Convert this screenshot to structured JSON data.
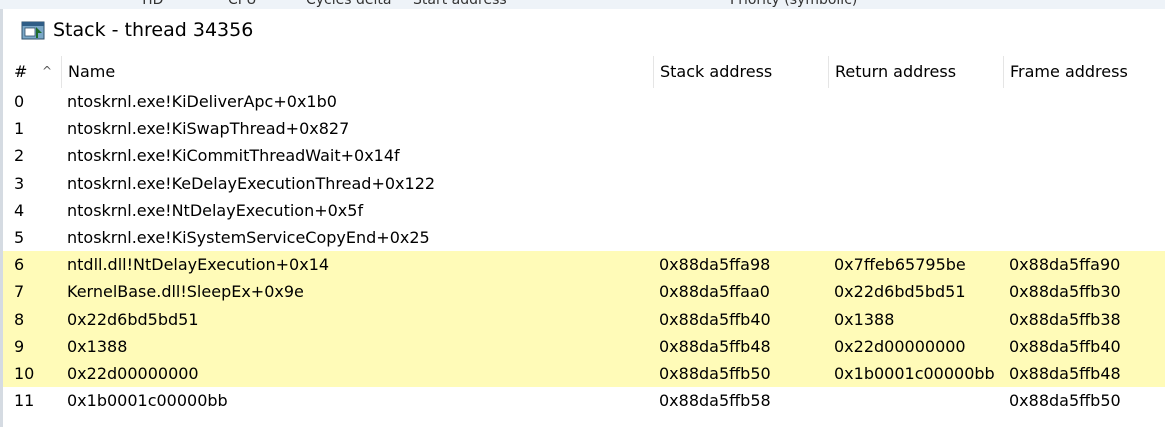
{
  "background_header": {
    "labels": [
      "TID",
      "CPU",
      "Cycles delta",
      "Start address",
      "Priority (symbolic)"
    ]
  },
  "window": {
    "title": "Stack - thread 34356",
    "icon": "stack-window-icon"
  },
  "columns": {
    "num": "#",
    "name": "Name",
    "stack_address": "Stack address",
    "return_address": "Return address",
    "frame_address": "Frame address"
  },
  "colors": {
    "highlight": "#fffbb8",
    "background": "#ffffff"
  },
  "rows": [
    {
      "num": "0",
      "name": "ntoskrnl.exe!KiDeliverApc+0x1b0",
      "stack": "",
      "ret": "",
      "frame": "",
      "highlight": false
    },
    {
      "num": "1",
      "name": "ntoskrnl.exe!KiSwapThread+0x827",
      "stack": "",
      "ret": "",
      "frame": "",
      "highlight": false
    },
    {
      "num": "2",
      "name": "ntoskrnl.exe!KiCommitThreadWait+0x14f",
      "stack": "",
      "ret": "",
      "frame": "",
      "highlight": false
    },
    {
      "num": "3",
      "name": "ntoskrnl.exe!KeDelayExecutionThread+0x122",
      "stack": "",
      "ret": "",
      "frame": "",
      "highlight": false
    },
    {
      "num": "4",
      "name": "ntoskrnl.exe!NtDelayExecution+0x5f",
      "stack": "",
      "ret": "",
      "frame": "",
      "highlight": false
    },
    {
      "num": "5",
      "name": "ntoskrnl.exe!KiSystemServiceCopyEnd+0x25",
      "stack": "",
      "ret": "",
      "frame": "",
      "highlight": false
    },
    {
      "num": "6",
      "name": "ntdll.dll!NtDelayExecution+0x14",
      "stack": "0x88da5ffa98",
      "ret": "0x7ffeb65795be",
      "frame": "0x88da5ffa90",
      "highlight": true
    },
    {
      "num": "7",
      "name": "KernelBase.dll!SleepEx+0x9e",
      "stack": "0x88da5ffaa0",
      "ret": "0x22d6bd5bd51",
      "frame": "0x88da5ffb30",
      "highlight": true
    },
    {
      "num": "8",
      "name": "0x22d6bd5bd51",
      "stack": "0x88da5ffb40",
      "ret": "0x1388",
      "frame": "0x88da5ffb38",
      "highlight": true
    },
    {
      "num": "9",
      "name": "0x1388",
      "stack": "0x88da5ffb48",
      "ret": "0x22d00000000",
      "frame": "0x88da5ffb40",
      "highlight": true
    },
    {
      "num": "10",
      "name": "0x22d00000000",
      "stack": "0x88da5ffb50",
      "ret": "0x1b0001c00000bb",
      "frame": "0x88da5ffb48",
      "highlight": true
    },
    {
      "num": "11",
      "name": "0x1b0001c00000bb",
      "stack": "0x88da5ffb58",
      "ret": "",
      "frame": "0x88da5ffb50",
      "highlight": false
    }
  ]
}
